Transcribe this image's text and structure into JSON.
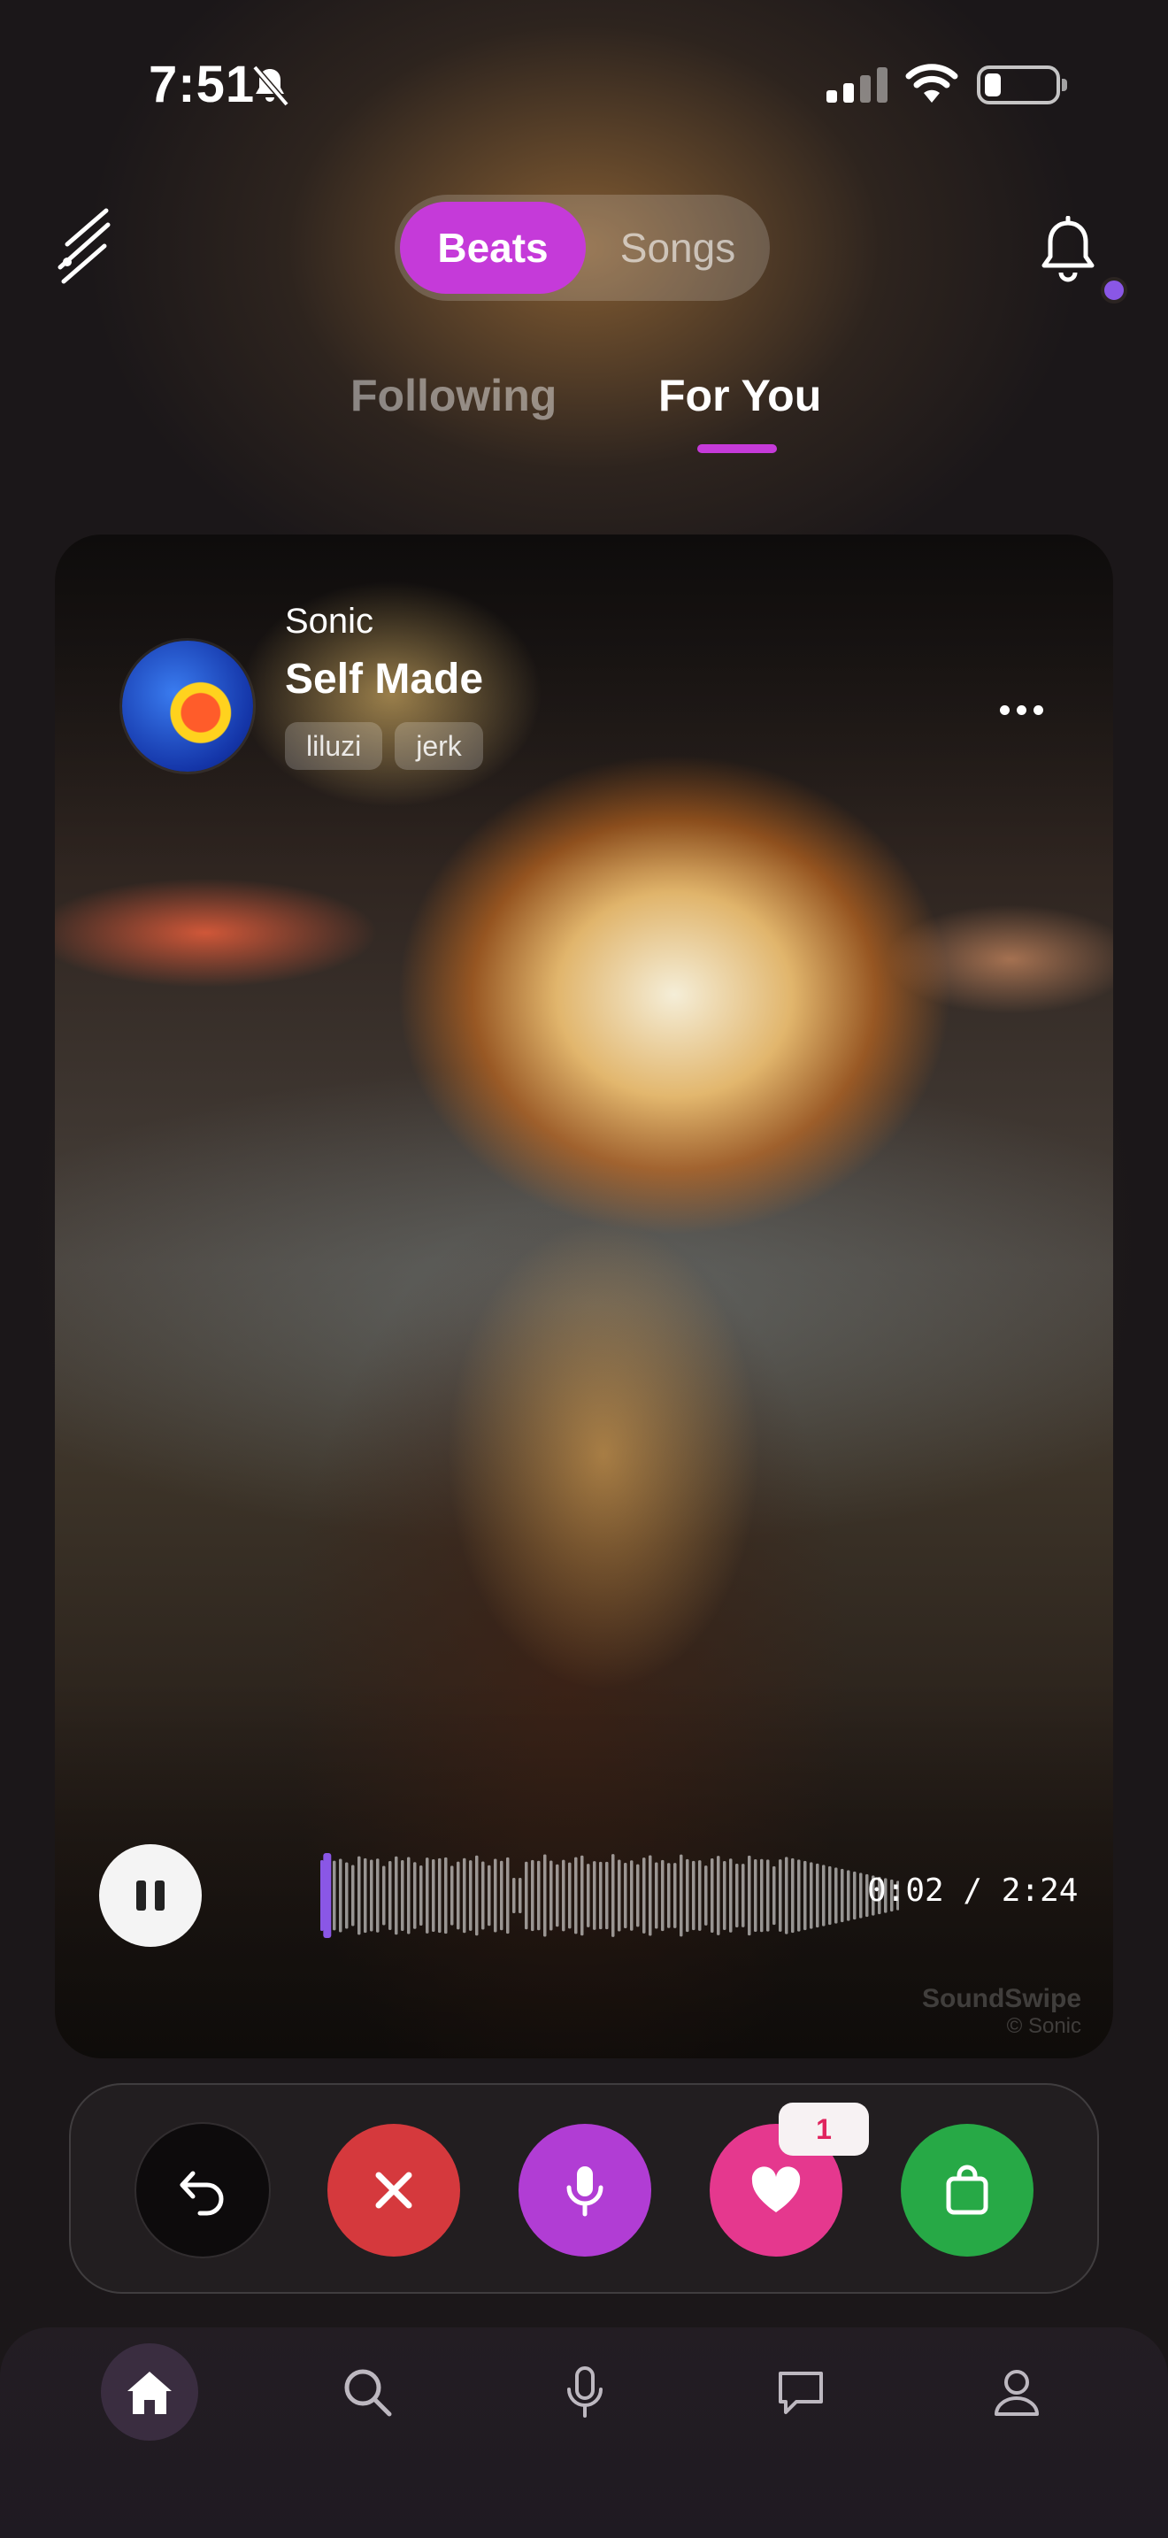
{
  "status_bar": {
    "time": "7:51"
  },
  "header": {
    "segment": {
      "active": "Beats",
      "inactive": "Songs"
    },
    "tabs": {
      "following": "Following",
      "for_you": "For You",
      "active": "For You"
    }
  },
  "card": {
    "artist": "Sonic",
    "title": "Self Made",
    "tags": [
      "liluzi",
      "jerk"
    ],
    "player": {
      "time": "0:02 / 2:24",
      "progress": 0.014,
      "state": "playing"
    },
    "watermark": {
      "name": "SoundSwipe",
      "copyright": "© Sonic"
    }
  },
  "actions": {
    "like_count": "1",
    "icons": [
      "undo-icon",
      "close-icon",
      "mic-icon",
      "heart-icon",
      "bag-icon"
    ]
  },
  "colors": {
    "accent": "#c53ad9",
    "reject": "#d5393d",
    "record": "#b13dd4",
    "like": "#e5388e",
    "cart": "#27a946"
  },
  "bottom_nav": {
    "items": [
      "home-icon",
      "search-icon",
      "mic-icon",
      "chat-icon",
      "profile-icon"
    ],
    "active": "home-icon"
  }
}
